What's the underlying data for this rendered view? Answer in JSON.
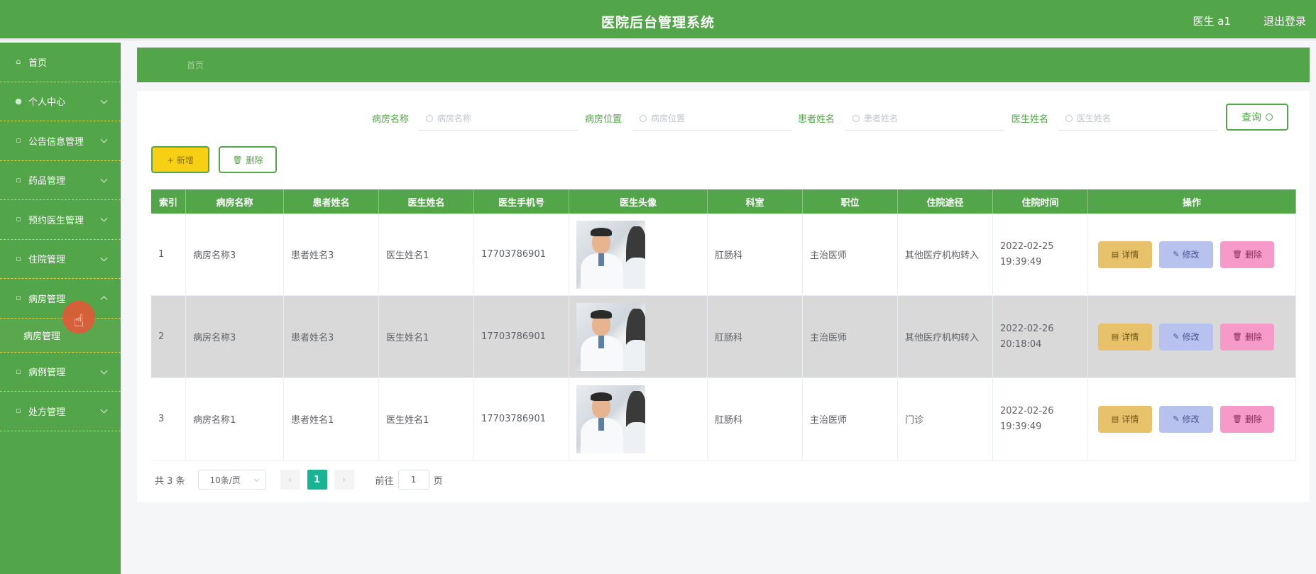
{
  "header": {
    "title": "医院后台管理系统",
    "user": "医生 a1",
    "logout": "退出登录"
  },
  "sidebar": {
    "items": [
      {
        "label": "首页",
        "has_chevron": false
      },
      {
        "label": "个人中心",
        "has_chevron": true
      },
      {
        "label": "公告信息管理",
        "has_chevron": true
      },
      {
        "label": "药品管理",
        "has_chevron": true
      },
      {
        "label": "预约医生管理",
        "has_chevron": true
      },
      {
        "label": "住院管理",
        "has_chevron": true
      },
      {
        "label": "病房管理",
        "has_chevron": true,
        "expanded": true
      },
      {
        "label": "病例管理",
        "has_chevron": true
      },
      {
        "label": "处方管理",
        "has_chevron": true
      }
    ],
    "submenu": {
      "label": "病房管理"
    }
  },
  "breadcrumb": {
    "text": "首页"
  },
  "search": {
    "fields": [
      {
        "label": "病房名称",
        "placeholder": "病房名称"
      },
      {
        "label": "病房位置",
        "placeholder": "病房位置"
      },
      {
        "label": "患者姓名",
        "placeholder": "患者姓名"
      },
      {
        "label": "医生姓名",
        "placeholder": "医生姓名"
      }
    ],
    "query_label": "查询"
  },
  "actions": {
    "add_label": "+ 新增",
    "delete_label": "删除"
  },
  "table": {
    "columns": [
      "索引",
      "病房名称",
      "患者姓名",
      "医生姓名",
      "医生手机号",
      "医生头像",
      "科室",
      "职位",
      "住院途径",
      "住院时间",
      "操作"
    ],
    "rows": [
      {
        "index": "1",
        "room": "病房名称3",
        "patient": "患者姓名3",
        "doctor": "医生姓名1",
        "phone": "17703786901",
        "dept": "肛肠科",
        "position": "主治医师",
        "route": "其他医疗机构转入",
        "time": "2022-02-25 19:39:49"
      },
      {
        "index": "2",
        "room": "病房名称3",
        "patient": "患者姓名3",
        "doctor": "医生姓名1",
        "phone": "17703786901",
        "dept": "肛肠科",
        "position": "主治医师",
        "route": "其他医疗机构转入",
        "time": "2022-02-26 20:18:04"
      },
      {
        "index": "3",
        "room": "病房名称1",
        "patient": "患者姓名1",
        "doctor": "医生姓名1",
        "phone": "17703786901",
        "dept": "肛肠科",
        "position": "主治医师",
        "route": "门诊",
        "time": "2022-02-26 19:39:49"
      }
    ],
    "row_actions": {
      "detail": "详情",
      "edit": "修改",
      "delete": "删除"
    }
  },
  "pagination": {
    "total": "共 3 条",
    "page_size": "10条/页",
    "current": "1",
    "goto_label": "前往",
    "goto_value": "1",
    "page_suffix": "页"
  },
  "colors": {
    "primary_green": "#52a548",
    "yellow": "#f7cf14",
    "detail": "#e8c26b",
    "edit": "#b8c2ee",
    "delete": "#f59ac9",
    "page_active": "#1ab394",
    "cursor": "#e05a3a"
  }
}
